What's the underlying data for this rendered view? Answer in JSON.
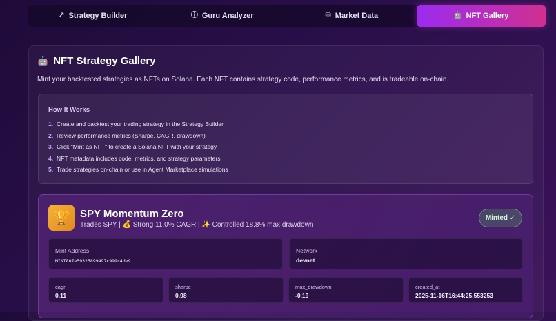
{
  "tabs": [
    {
      "label": "Strategy Builder",
      "icon": "trend-up-icon"
    },
    {
      "label": "Guru Analyzer",
      "icon": "info-circle-icon"
    },
    {
      "label": "Market Data",
      "icon": "coins-icon"
    },
    {
      "label": "NFT Gallery",
      "icon": "robot-icon",
      "active": true
    }
  ],
  "gallery": {
    "title": "NFT Strategy Gallery",
    "description": "Mint your backtested strategies as NFTs on Solana. Each NFT contains strategy code, performance metrics, and is tradeable on-chain."
  },
  "how": {
    "title": "How It Works",
    "steps": [
      {
        "num": "1.",
        "text": "Create and backtest your trading strategy in the Strategy Builder"
      },
      {
        "num": "2.",
        "text": "Review performance metrics (Sharpe, CAGR, drawdown)"
      },
      {
        "num": "3.",
        "text": "Click \"Mint as NFT\" to create a Solana NFT with your strategy"
      },
      {
        "num": "4.",
        "text": "NFT metadata includes code, metrics, and strategy parameters"
      },
      {
        "num": "5.",
        "text": "Trade strategies on-chain or use in Agent Marketplace simulations"
      }
    ]
  },
  "card": {
    "title": "SPY Momentum Zero",
    "subtitle": "Trades SPY | 💰 Strong 11.0% CAGR | ✨ Controlled 18.8% max drawdown",
    "badge": "Minted ✓",
    "mint_label": "Mint Address",
    "mint_value": "MINT807e59325899497c999c4de9",
    "network_label": "Network",
    "network_value": "devnet",
    "metrics": [
      {
        "label": "cagr",
        "value": "0.11"
      },
      {
        "label": "sharpe",
        "value": "0.98"
      },
      {
        "label": "max_drawdown",
        "value": "-0.19"
      },
      {
        "label": "created_at",
        "value": "2025-11-16T16:44:25.553253"
      }
    ]
  },
  "colors": {
    "accent_start": "#9b2bf0",
    "accent_end": "#d0308f",
    "trophy": "#f2b13c"
  }
}
